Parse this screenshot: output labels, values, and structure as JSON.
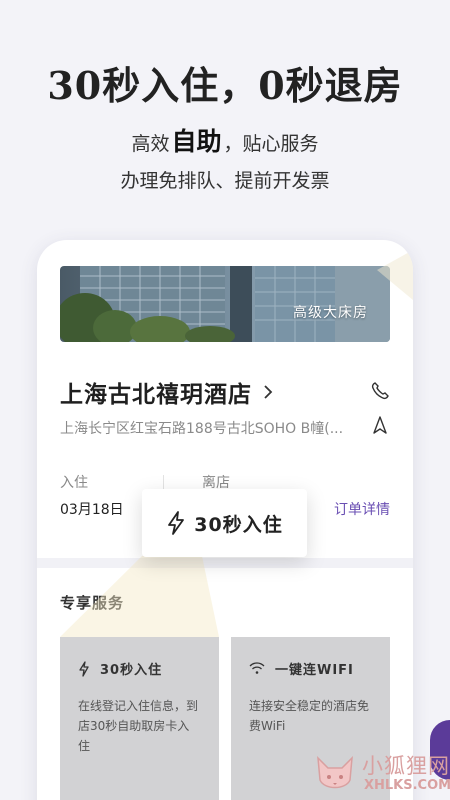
{
  "promo": {
    "title": "30秒入住，0秒退房",
    "sub1_pre": "高效",
    "sub1_highlight": "自助",
    "sub1_post": "，贴心服务",
    "sub2": "办理免排队、提前开发票"
  },
  "hotel": {
    "room_type": "高级大床房",
    "name": "上海古北禧玥酒店",
    "address": "上海长宁区红宝石路188号古北SOHO B幢(..."
  },
  "stay": {
    "checkin_label": "入住",
    "checkin_date": "03月18日",
    "checkout_label": "离店",
    "order_link": "订单详情"
  },
  "popup": {
    "label": "30秒入住"
  },
  "services": {
    "title": "专享服务",
    "items": [
      {
        "title": "30秒入住",
        "desc": "在线登记入住信息，到店30秒自助取房卡入住",
        "icon": "lightning-icon"
      },
      {
        "title": "一键连WIFI",
        "desc": "连接安全稳定的酒店免费WiFi",
        "icon": "wifi-icon"
      }
    ]
  },
  "watermark": {
    "cn": "小狐狸网",
    "en": "XHLKS.COM"
  },
  "colors": {
    "accent": "#6a4fb3",
    "background": "#f3f3f8",
    "card": "#d2d2d4"
  }
}
